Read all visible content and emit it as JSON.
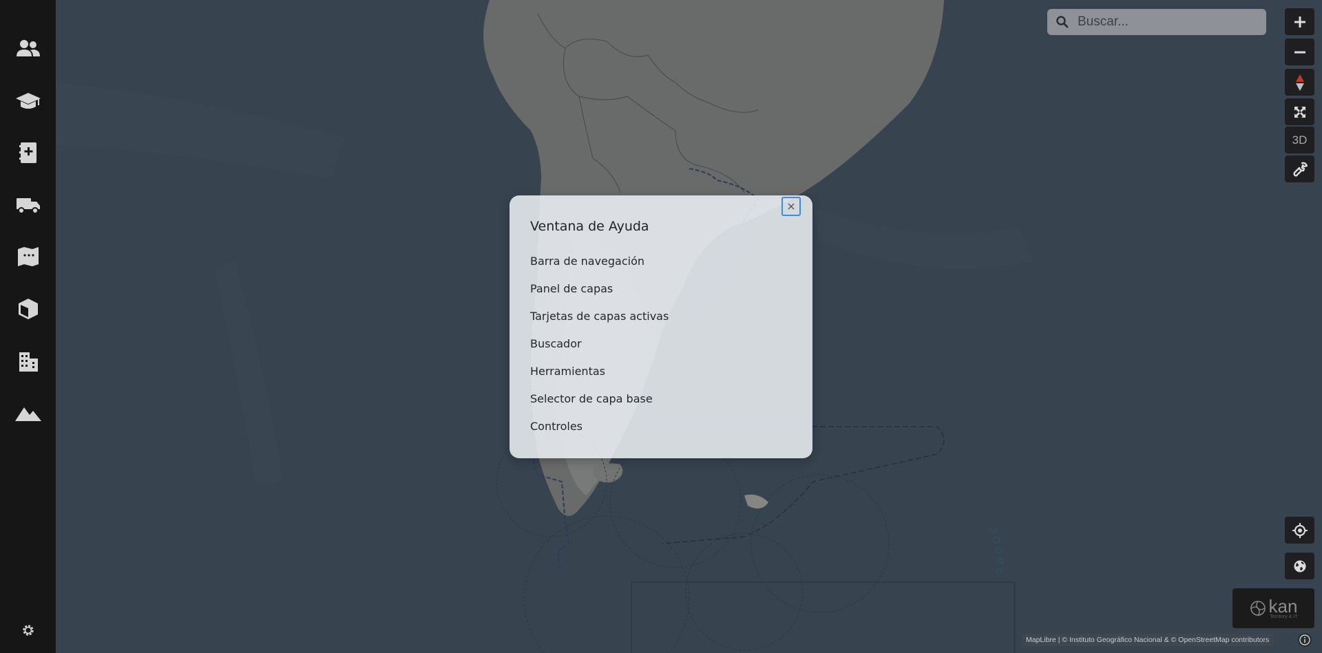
{
  "sidebar": {
    "items": [
      {
        "icon": "people-icon"
      },
      {
        "icon": "graduation-cap-icon"
      },
      {
        "icon": "medical-book-icon"
      },
      {
        "icon": "truck-icon"
      },
      {
        "icon": "map-icon"
      },
      {
        "icon": "cube-icon"
      },
      {
        "icon": "buildings-icon"
      },
      {
        "icon": "mountain-icon"
      }
    ],
    "settings_icon": "gear-icon"
  },
  "search": {
    "placeholder": "Buscar...",
    "icon": "search-icon"
  },
  "controls": {
    "zoom_in_icon": "plus-icon",
    "zoom_out_icon": "minus-icon",
    "compass_icon": "compass-icon",
    "fullscreen_icon": "fullscreen-icon",
    "terrain_label": "3D",
    "tools_icon": "wrench-icon",
    "locate_icon": "crosshair-icon",
    "globe_icon": "globe-icon"
  },
  "logo": {
    "text": "kan",
    "subtext": "Territory & IT"
  },
  "attribution": {
    "text": "MapLibre | © Instituto Geográfico Nacional & © OpenStreetMap contributors"
  },
  "help_modal": {
    "title": "Ventana de Ayuda",
    "items": [
      "Barra de navegación",
      "Panel de capas",
      "Tarjetas de capas activas",
      "Buscador",
      "Herramientas",
      "Selector de capa base",
      "Controles"
    ]
  },
  "colors": {
    "sidebar": "#161616",
    "ocean": "#3d4b57",
    "land": "#8f8e88",
    "modal_bg": "#eaeef2",
    "focus_ring": "#3a8dde",
    "compass_red": "#c0392b"
  }
}
